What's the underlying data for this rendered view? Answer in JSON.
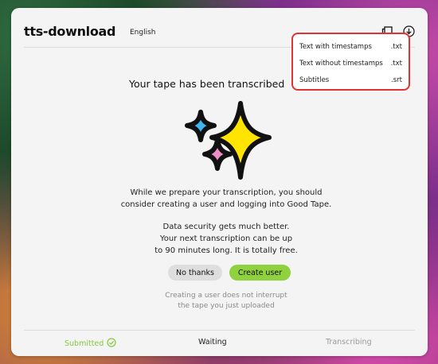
{
  "header": {
    "brand": "tts-download",
    "language": "English"
  },
  "icons": [
    "copy-icon",
    "download-icon",
    "sparkles-icon",
    "check-circle-icon"
  ],
  "dropdown": {
    "items": [
      {
        "label": "Text with timestamps",
        "ext": ".txt"
      },
      {
        "label": "Text without timestamps",
        "ext": ".txt"
      },
      {
        "label": "Subtitles",
        "ext": ".srt"
      }
    ],
    "highlight_color": "#e03333"
  },
  "main": {
    "headline": "Your tape has been transcribed",
    "para1_line1": "While we prepare your transcription, you should",
    "para1_line2": "consider creating a user and logging into Good Tape.",
    "para2_line1": "Data security gets much better.",
    "para2_line2": "Your next transcription can be up",
    "para2_line3": "to 90 minutes long. It is totally free.",
    "no_thanks": "No thanks",
    "create_user": "Create user",
    "note_line1": "Creating a user does not interrupt",
    "note_line2": "the tape you just uploaded"
  },
  "status": {
    "steps": [
      "Submitted",
      "Waiting",
      "Transcribing"
    ],
    "accent": "#8fd13f"
  }
}
